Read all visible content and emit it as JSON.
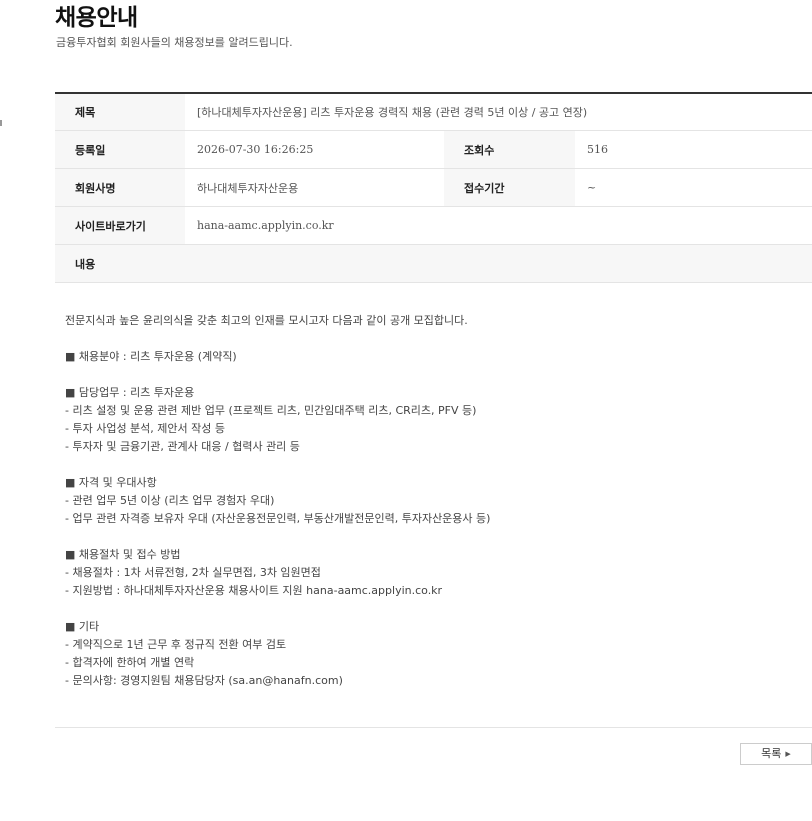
{
  "header": {
    "title": "채용안내",
    "subtitle": "금융투자협회 회원사들의 채용정보를 알려드립니다."
  },
  "detail": {
    "title_label": "제목",
    "title_value": "[하나대체투자자산운용] 리츠 투자운용 경력직 채용 (관련 경력 5년 이상 / 공고 연장)",
    "date_label": "등록일",
    "date_value": "2026-07-30 16:26:25",
    "views_label": "조회수",
    "views_value": "516",
    "company_label": "회원사명",
    "company_value": "하나대체투자자산운용",
    "period_label": "접수기간",
    "period_value": "~",
    "site_label": "사이트바로가기",
    "site_value": "hana-aamc.applyin.co.kr",
    "content_label": "내용"
  },
  "content": {
    "lines": [
      "전문지식과 높은 윤리의식을 갖춘 최고의 인재를 모시고자 다음과 같이 공개 모집합니다.",
      "",
      "■ 채용분야 : 리츠 투자운용 (계약직)",
      "",
      "■ 담당업무 : 리츠 투자운용",
      "- 리츠 설정 및 운용 관련 제반 업무 (프로젝트 리츠, 민간임대주택 리츠, CR리츠, PFV 등)",
      "- 투자 사업성 분석, 제안서 작성 등",
      "- 투자자 및 금융기관, 관계사 대응 / 협력사 관리 등",
      "",
      "■ 자격 및 우대사항",
      "- 관련 업무 5년 이상 (리츠 업무 경험자 우대)",
      "- 업무 관련 자격증 보유자 우대 (자산운용전문인력, 부동산개발전문인력, 투자자산운용사 등)",
      "",
      "■ 채용절차 및 접수 방법",
      "- 채용절차 : 1차 서류전형, 2차 실무면접, 3차 임원면접",
      "- 지원방법 : 하나대체투자자산운용 채용사이트 지원 hana-aamc.applyin.co.kr",
      "",
      "■ 기타",
      "- 계약직으로 1년 근무 후 정규직 전환 여부 검토",
      "- 합격자에 한하여 개별 연락",
      "- 문의사항: 경영지원팀 채용담당자 (sa.an@hanafn.com)"
    ]
  },
  "footer": {
    "list_button_label": "목록",
    "list_button_icon": "arrow-right-icon"
  }
}
